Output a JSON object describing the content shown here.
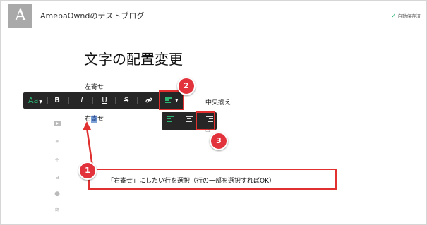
{
  "header": {
    "logo_letter": "A",
    "blog_title": "AmebaOwndのテストブログ",
    "autosave_text": "自動保存済"
  },
  "content": {
    "page_title": "文字の配置変更",
    "line_left": "左寄せ",
    "line_center": "中央揃え",
    "line_right_pre": "右",
    "line_right_sel": "寄",
    "line_right_post": "せ"
  },
  "toolbar": {
    "font_label": "Aa",
    "bold_label": "B",
    "italic_label": "I",
    "underline_label": "U",
    "strike_label": "S",
    "link_icon": "link-icon"
  },
  "annotations": {
    "step1": "1",
    "step2": "2",
    "step3": "3",
    "callout_text": "「右寄せ」にしたい行を選択（行の一部を選択すればOK）"
  },
  "colors": {
    "accent_green": "#2bb673",
    "annotation_red": "#e03030",
    "toolbar_bg": "#262626"
  }
}
